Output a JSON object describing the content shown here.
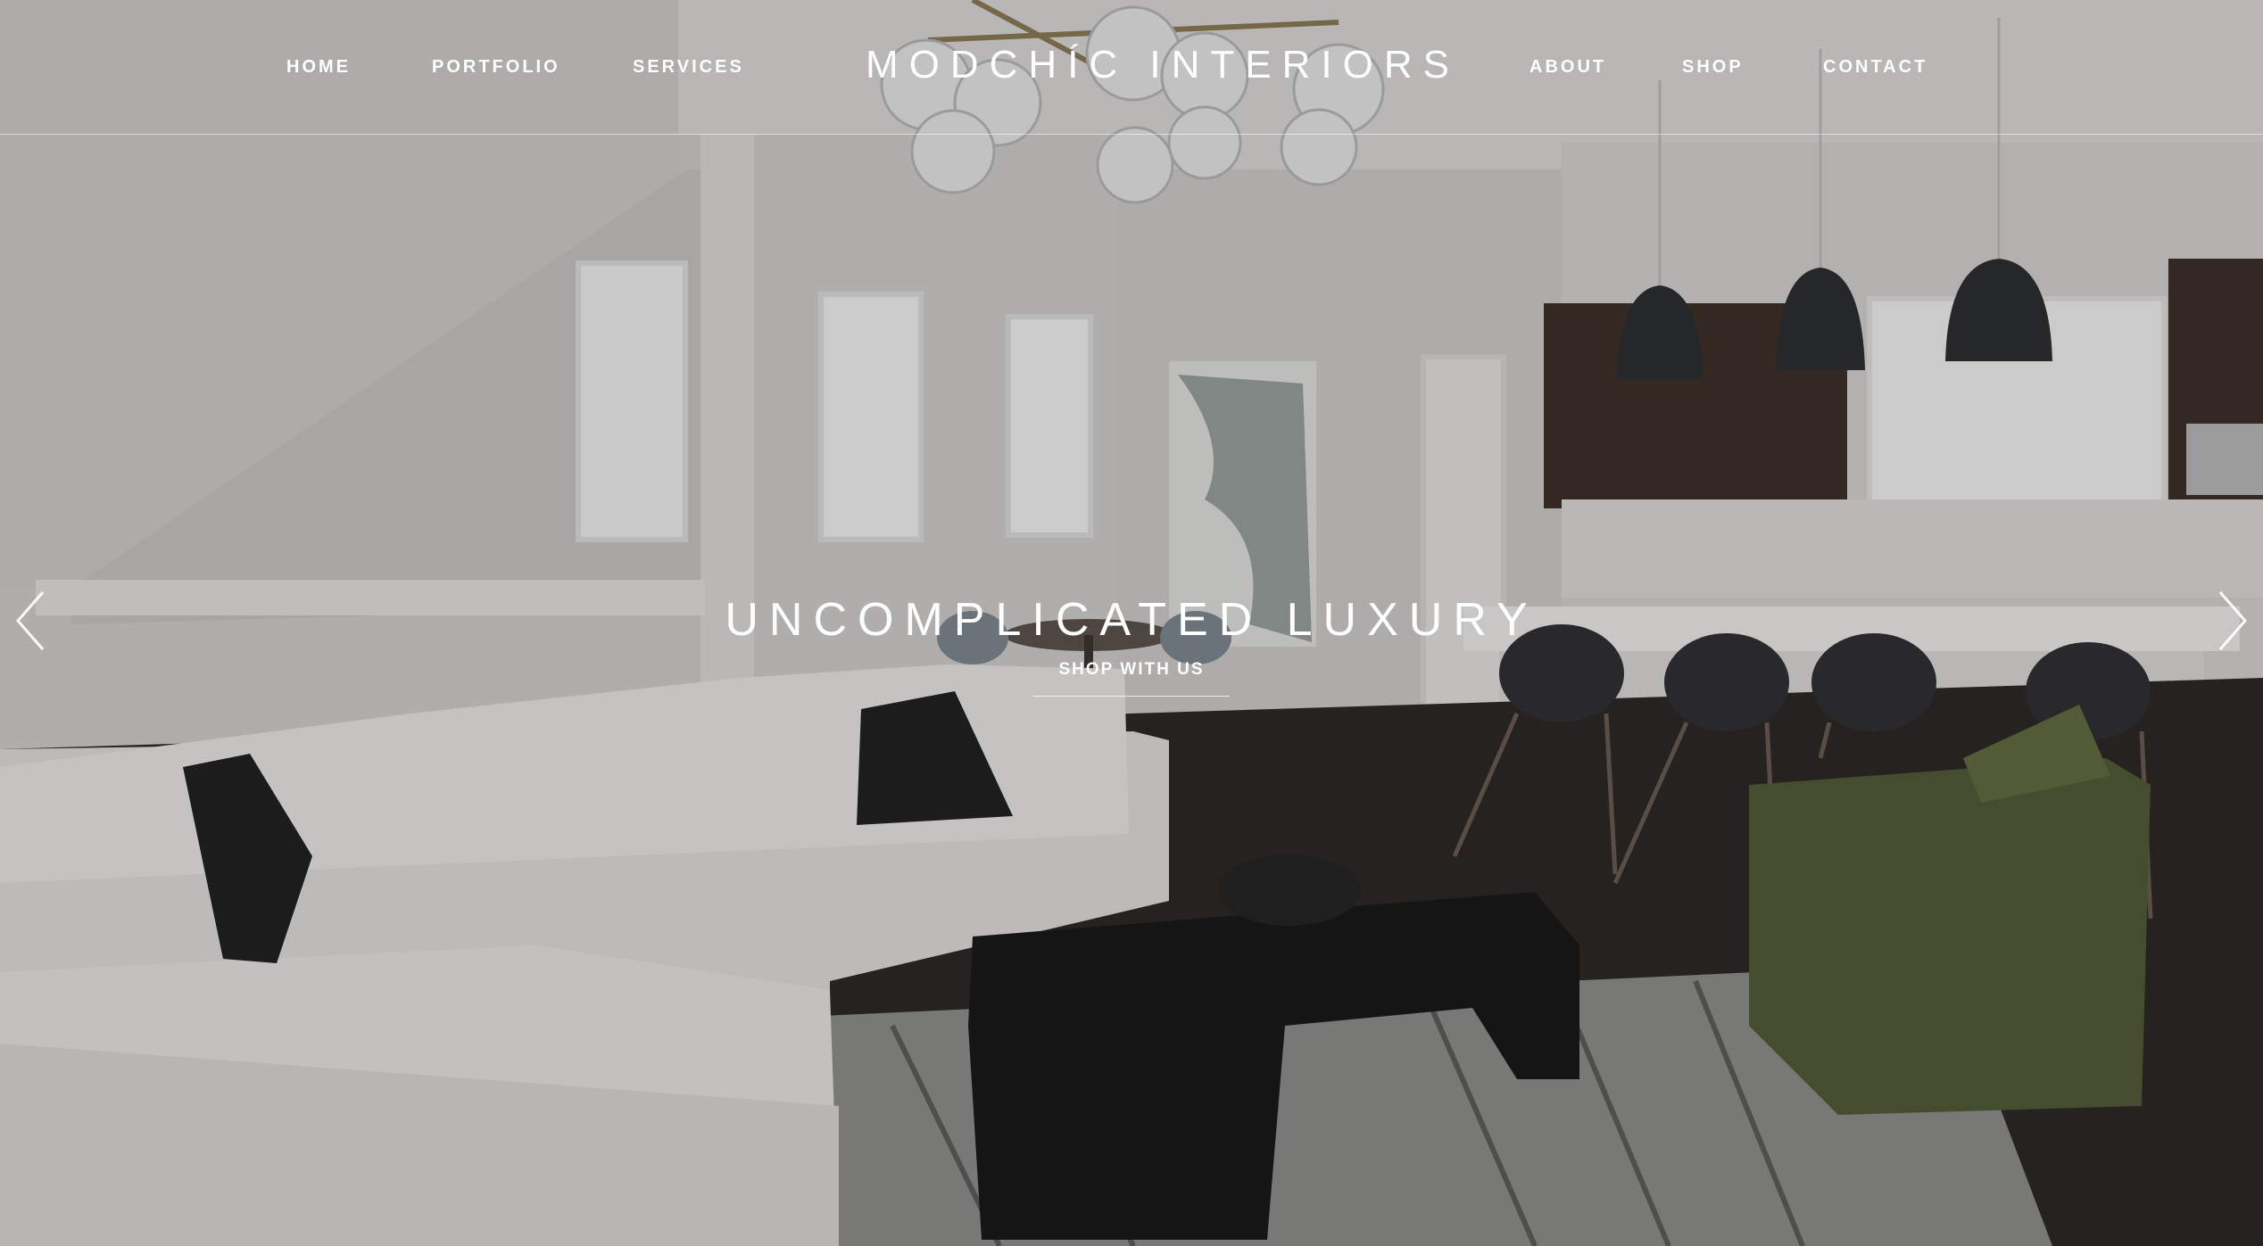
{
  "brand": {
    "logo_text": "MODCHÍC INTERIORS"
  },
  "nav": {
    "left": [
      {
        "label": "HOME"
      },
      {
        "label": "PORTFOLIO"
      },
      {
        "label": "SERVICES"
      }
    ],
    "right": [
      {
        "label": "ABOUT"
      },
      {
        "label": "SHOP"
      },
      {
        "label": "CONTACT"
      }
    ]
  },
  "hero": {
    "headline": "UNCOMPLICATED LUXURY",
    "cta_label": "SHOP WITH US",
    "prev_icon": "chevron-left-icon",
    "next_icon": "chevron-right-icon"
  },
  "colors": {
    "text": "#ffffff",
    "wall": "#d4d2d0",
    "floor": "#2a2523",
    "cabinet": "#3b2c27",
    "sofa": "#e8e6e3",
    "chair_green": "#4f5a34",
    "table": "#151515"
  }
}
